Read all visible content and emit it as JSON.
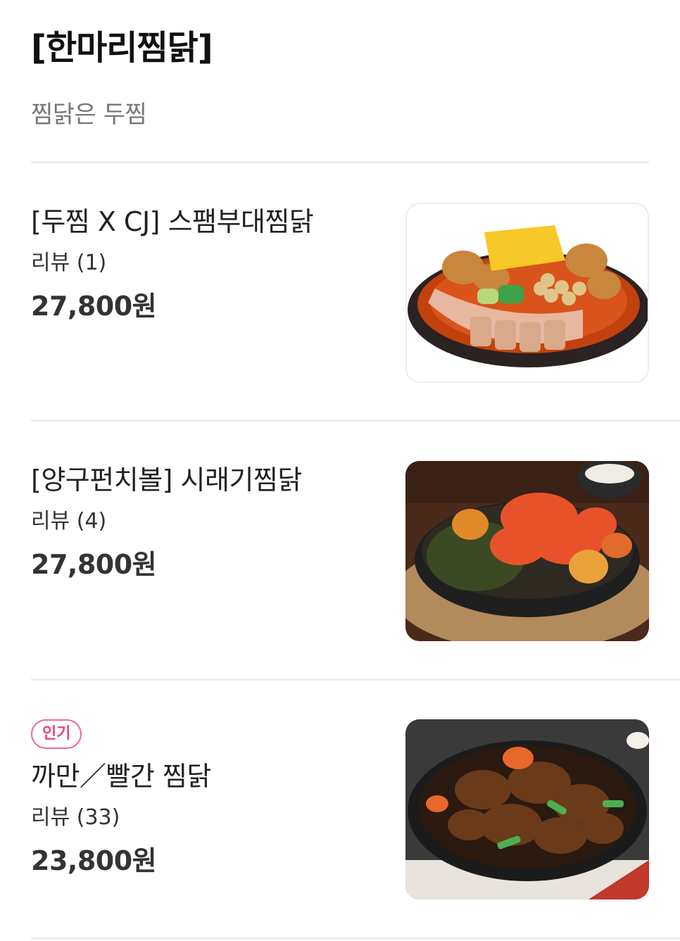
{
  "section": {
    "title": "[한마리찜닭]",
    "description": "찜닭은 두찜"
  },
  "menu_items": [
    {
      "name": "[두찜 X CJ] 스팸부대찜닭",
      "review": "리뷰 (1)",
      "price": "27,800원",
      "badge": null
    },
    {
      "name": "[양구펀치볼] 시래기찜닭",
      "review": "리뷰 (4)",
      "price": "27,800원",
      "badge": null
    },
    {
      "name": "까만／빨간 찜닭",
      "review": "리뷰 (33)",
      "price": "23,800원",
      "badge": "인기"
    }
  ],
  "colors": {
    "badge": "#e8457a",
    "divider": "#eeeeee",
    "description": "#777777"
  }
}
